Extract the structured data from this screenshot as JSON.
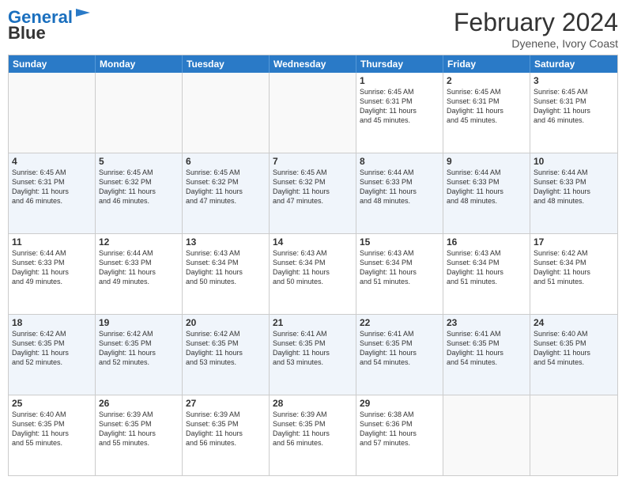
{
  "header": {
    "logo_line1": "General",
    "logo_line2": "Blue",
    "month_year": "February 2024",
    "location": "Dyenene, Ivory Coast"
  },
  "weekdays": [
    "Sunday",
    "Monday",
    "Tuesday",
    "Wednesday",
    "Thursday",
    "Friday",
    "Saturday"
  ],
  "weeks": [
    [
      {
        "day": "",
        "info": ""
      },
      {
        "day": "",
        "info": ""
      },
      {
        "day": "",
        "info": ""
      },
      {
        "day": "",
        "info": ""
      },
      {
        "day": "1",
        "info": "Sunrise: 6:45 AM\nSunset: 6:31 PM\nDaylight: 11 hours\nand 45 minutes."
      },
      {
        "day": "2",
        "info": "Sunrise: 6:45 AM\nSunset: 6:31 PM\nDaylight: 11 hours\nand 45 minutes."
      },
      {
        "day": "3",
        "info": "Sunrise: 6:45 AM\nSunset: 6:31 PM\nDaylight: 11 hours\nand 46 minutes."
      }
    ],
    [
      {
        "day": "4",
        "info": "Sunrise: 6:45 AM\nSunset: 6:31 PM\nDaylight: 11 hours\nand 46 minutes."
      },
      {
        "day": "5",
        "info": "Sunrise: 6:45 AM\nSunset: 6:32 PM\nDaylight: 11 hours\nand 46 minutes."
      },
      {
        "day": "6",
        "info": "Sunrise: 6:45 AM\nSunset: 6:32 PM\nDaylight: 11 hours\nand 47 minutes."
      },
      {
        "day": "7",
        "info": "Sunrise: 6:45 AM\nSunset: 6:32 PM\nDaylight: 11 hours\nand 47 minutes."
      },
      {
        "day": "8",
        "info": "Sunrise: 6:44 AM\nSunset: 6:33 PM\nDaylight: 11 hours\nand 48 minutes."
      },
      {
        "day": "9",
        "info": "Sunrise: 6:44 AM\nSunset: 6:33 PM\nDaylight: 11 hours\nand 48 minutes."
      },
      {
        "day": "10",
        "info": "Sunrise: 6:44 AM\nSunset: 6:33 PM\nDaylight: 11 hours\nand 48 minutes."
      }
    ],
    [
      {
        "day": "11",
        "info": "Sunrise: 6:44 AM\nSunset: 6:33 PM\nDaylight: 11 hours\nand 49 minutes."
      },
      {
        "day": "12",
        "info": "Sunrise: 6:44 AM\nSunset: 6:33 PM\nDaylight: 11 hours\nand 49 minutes."
      },
      {
        "day": "13",
        "info": "Sunrise: 6:43 AM\nSunset: 6:34 PM\nDaylight: 11 hours\nand 50 minutes."
      },
      {
        "day": "14",
        "info": "Sunrise: 6:43 AM\nSunset: 6:34 PM\nDaylight: 11 hours\nand 50 minutes."
      },
      {
        "day": "15",
        "info": "Sunrise: 6:43 AM\nSunset: 6:34 PM\nDaylight: 11 hours\nand 51 minutes."
      },
      {
        "day": "16",
        "info": "Sunrise: 6:43 AM\nSunset: 6:34 PM\nDaylight: 11 hours\nand 51 minutes."
      },
      {
        "day": "17",
        "info": "Sunrise: 6:42 AM\nSunset: 6:34 PM\nDaylight: 11 hours\nand 51 minutes."
      }
    ],
    [
      {
        "day": "18",
        "info": "Sunrise: 6:42 AM\nSunset: 6:35 PM\nDaylight: 11 hours\nand 52 minutes."
      },
      {
        "day": "19",
        "info": "Sunrise: 6:42 AM\nSunset: 6:35 PM\nDaylight: 11 hours\nand 52 minutes."
      },
      {
        "day": "20",
        "info": "Sunrise: 6:42 AM\nSunset: 6:35 PM\nDaylight: 11 hours\nand 53 minutes."
      },
      {
        "day": "21",
        "info": "Sunrise: 6:41 AM\nSunset: 6:35 PM\nDaylight: 11 hours\nand 53 minutes."
      },
      {
        "day": "22",
        "info": "Sunrise: 6:41 AM\nSunset: 6:35 PM\nDaylight: 11 hours\nand 54 minutes."
      },
      {
        "day": "23",
        "info": "Sunrise: 6:41 AM\nSunset: 6:35 PM\nDaylight: 11 hours\nand 54 minutes."
      },
      {
        "day": "24",
        "info": "Sunrise: 6:40 AM\nSunset: 6:35 PM\nDaylight: 11 hours\nand 54 minutes."
      }
    ],
    [
      {
        "day": "25",
        "info": "Sunrise: 6:40 AM\nSunset: 6:35 PM\nDaylight: 11 hours\nand 55 minutes."
      },
      {
        "day": "26",
        "info": "Sunrise: 6:39 AM\nSunset: 6:35 PM\nDaylight: 11 hours\nand 55 minutes."
      },
      {
        "day": "27",
        "info": "Sunrise: 6:39 AM\nSunset: 6:35 PM\nDaylight: 11 hours\nand 56 minutes."
      },
      {
        "day": "28",
        "info": "Sunrise: 6:39 AM\nSunset: 6:35 PM\nDaylight: 11 hours\nand 56 minutes."
      },
      {
        "day": "29",
        "info": "Sunrise: 6:38 AM\nSunset: 6:36 PM\nDaylight: 11 hours\nand 57 minutes."
      },
      {
        "day": "",
        "info": ""
      },
      {
        "day": "",
        "info": ""
      }
    ]
  ]
}
